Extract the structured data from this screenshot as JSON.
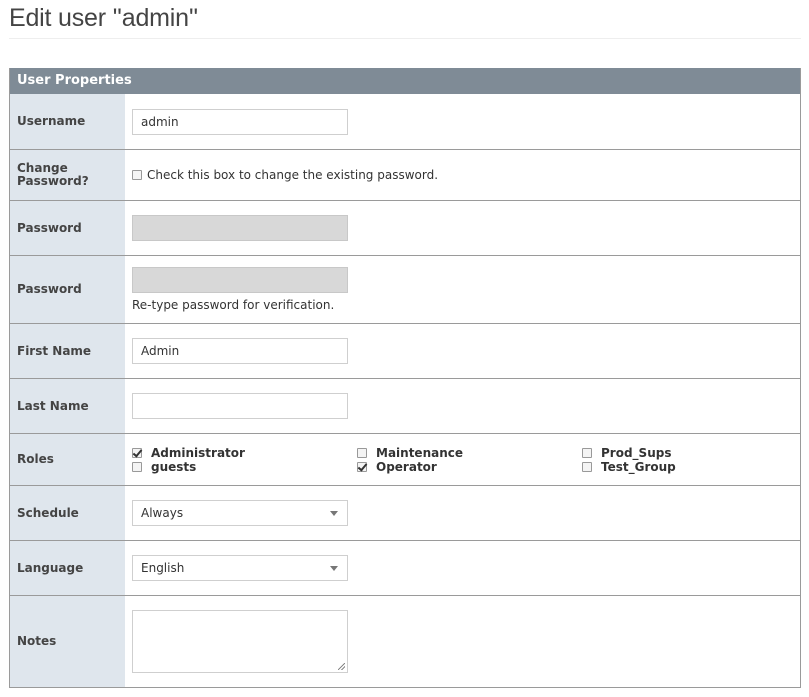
{
  "page": {
    "title": "Edit user ''admin''"
  },
  "section": {
    "title": "User Properties"
  },
  "fields": {
    "username": {
      "label": "Username",
      "value": "admin"
    },
    "change_password": {
      "label": "Change Password?",
      "text": "Check this box to change the existing password.",
      "checked": false
    },
    "password": {
      "label": "Password",
      "value": ""
    },
    "password_confirm": {
      "label": "Password",
      "value": "",
      "hint": "Re-type password for verification."
    },
    "first_name": {
      "label": "First Name",
      "value": "Admin"
    },
    "last_name": {
      "label": "Last Name",
      "value": ""
    },
    "roles": {
      "label": "Roles",
      "items": [
        {
          "name": "Administrator",
          "checked": true
        },
        {
          "name": "Maintenance",
          "checked": false
        },
        {
          "name": "Prod_Sups",
          "checked": false
        },
        {
          "name": "guests",
          "checked": false
        },
        {
          "name": "Operator",
          "checked": true
        },
        {
          "name": "Test_Group",
          "checked": false
        }
      ]
    },
    "schedule": {
      "label": "Schedule",
      "value": "Always"
    },
    "language": {
      "label": "Language",
      "value": "English"
    },
    "notes": {
      "label": "Notes",
      "value": ""
    }
  }
}
